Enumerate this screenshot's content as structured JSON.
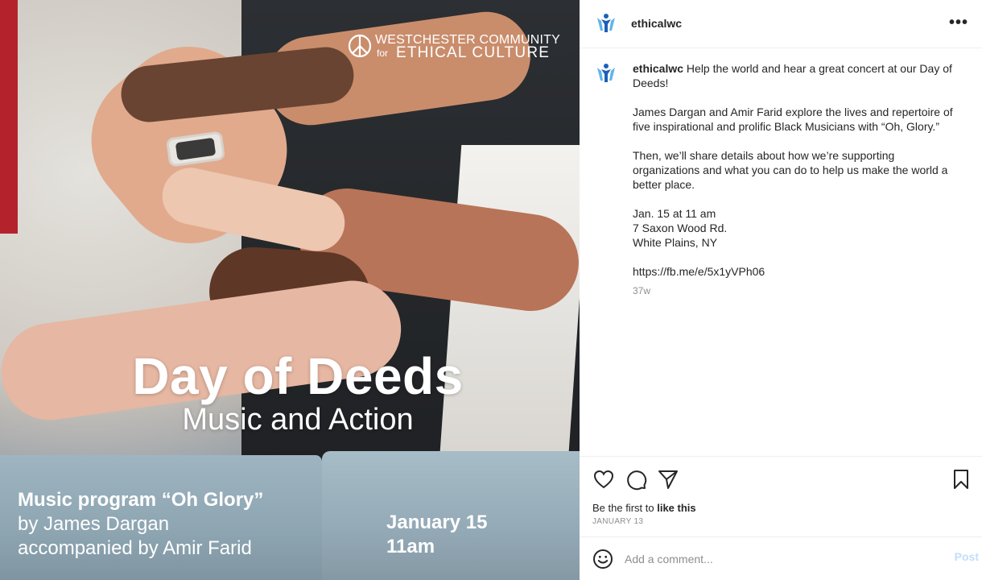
{
  "post": {
    "brand_line1": "WESTCHESTER COMMUNITY",
    "brand_for": "for",
    "brand_line2": "ETHICAL CULTURE",
    "title": "Day of Deeds",
    "subtitle": "Music and Action",
    "program_line1": "Music program “Oh Glory”",
    "program_line2": "by James Dargan",
    "program_line3": "accompanied by Amir Farid",
    "date_line": "January 15",
    "time_line": "11am"
  },
  "header": {
    "username": "ethicalwc",
    "more_icon": "more-horizontal-icon",
    "more_label": "•••"
  },
  "caption": {
    "username": "ethicalwc",
    "intro": "Help the world and hear a great concert at our Day of Deeds!",
    "para2": "James Dargan and Amir Farid explore the lives and repertoire of five inspirational and prolific Black Musicians with “Oh, Glory.”",
    "para3": "Then, we’ll share details about how we’re supporting organizations and what you can do to help us make the world a better place.",
    "addr1": "Jan. 15 at 11 am",
    "addr2": "7 Saxon Wood Rd.",
    "addr3": "White Plains, NY",
    "link": "https://fb.me/e/5x1yVPh06",
    "time_ago": "37w"
  },
  "actions": {
    "icons": [
      "heart-icon",
      "comment-icon",
      "share-icon",
      "bookmark-icon"
    ],
    "likes_prefix": "Be the first to",
    "likes_bold": "like this",
    "date": "JANUARY 13"
  },
  "comment": {
    "placeholder": "Add a comment...",
    "post_label": "Post",
    "emoji_icon": "smiley-icon"
  },
  "colors": {
    "brand_blue": "#2a7fd4",
    "link_disabled": "#c0dffd",
    "secondary_text": "#8e8e8e"
  }
}
